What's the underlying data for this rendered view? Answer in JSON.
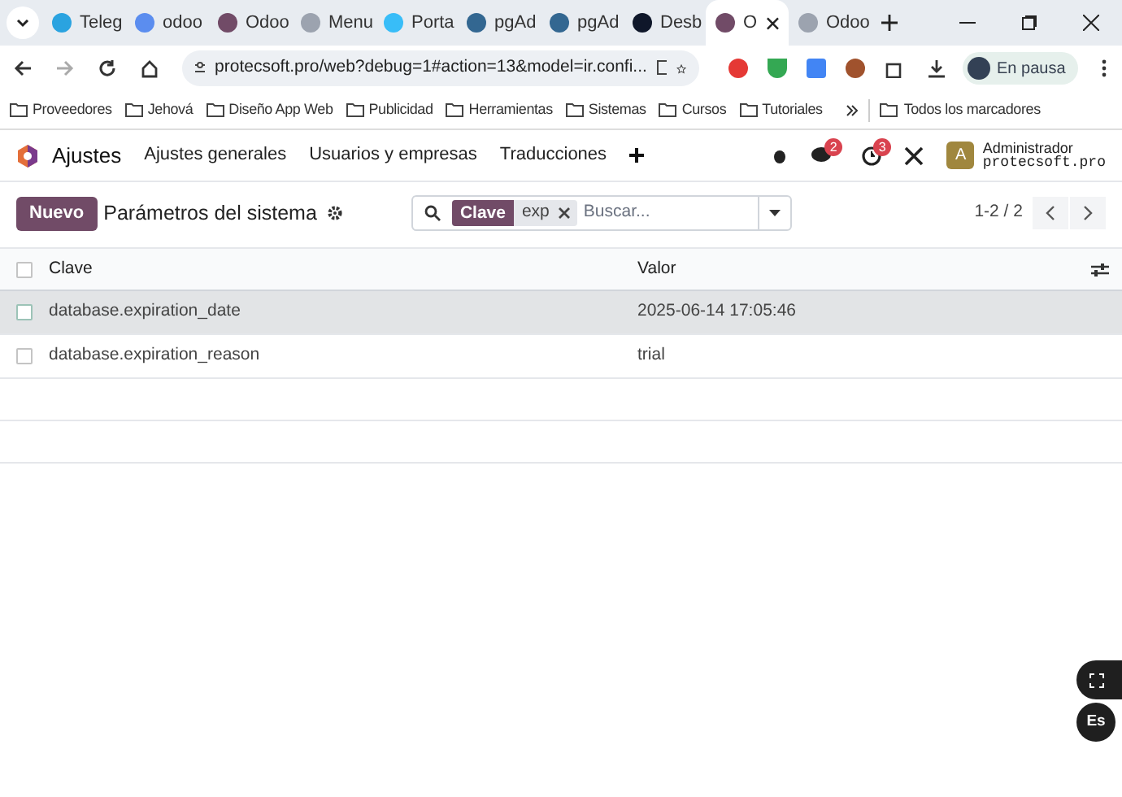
{
  "browser": {
    "tabs": [
      {
        "label": "Teleg",
        "color": "#2aa3e0",
        "selected": false
      },
      {
        "label": "odoo",
        "color": "#5b8def",
        "selected": false
      },
      {
        "label": "Odoo",
        "color": "#714b67",
        "selected": false
      },
      {
        "label": "Menu",
        "color": "#9ca3af",
        "selected": false
      },
      {
        "label": "Porta",
        "color": "#38bdf8",
        "selected": false
      },
      {
        "label": "pgAd",
        "color": "#336791",
        "selected": false
      },
      {
        "label": "pgAd",
        "color": "#336791",
        "selected": false
      },
      {
        "label": "Desb",
        "color": "#0f172a",
        "selected": false
      },
      {
        "label": "O",
        "color": "#714b67",
        "selected": true
      },
      {
        "label": "Odoo",
        "color": "#9ca3af",
        "selected": false
      }
    ],
    "url": "protecsoft.pro/web?debug=1#action=13&model=ir.confi...",
    "profile": "En pausa",
    "bookmarks": [
      "Proveedores",
      "Jehová",
      "Diseño App Web",
      "Publicidad",
      "Herramientas",
      "Sistemas",
      "Cursos",
      "Tutoriales"
    ],
    "all_bookmarks": "Todos los marcadores"
  },
  "app": {
    "name": "Ajustes",
    "menu": [
      "Ajustes generales",
      "Usuarios y empresas",
      "Traducciones"
    ],
    "messages_count": "2",
    "activities_count": "3",
    "avatar": "A",
    "user": "Administrador",
    "database": "protecsoft.pro"
  },
  "control_panel": {
    "new_button": "Nuevo",
    "title": "Parámetros del sistema",
    "facet_label": "Clave",
    "facet_value": "exp",
    "search_placeholder": "Buscar...",
    "pager": "1-2 / 2"
  },
  "table": {
    "select_all_checked": false,
    "columns": [
      "Clave",
      "Valor"
    ],
    "rows": [
      {
        "key": "database.expiration_date",
        "value": "2025-06-14 17:05:46",
        "highlighted": true,
        "checked": false
      },
      {
        "key": "database.expiration_reason",
        "value": "trial",
        "highlighted": false,
        "checked": false
      }
    ]
  },
  "floating": {
    "language": "Es"
  }
}
